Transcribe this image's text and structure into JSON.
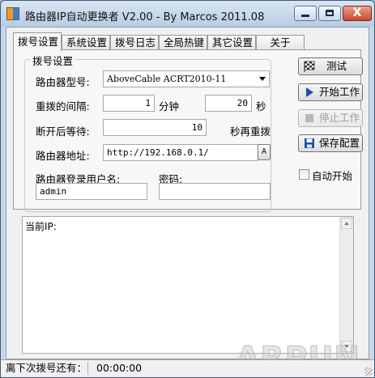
{
  "window": {
    "title": "路由器IP自动更换者 V2.00 - By Marcos 2011.08",
    "close_glyph": "X"
  },
  "tabs": [
    "拨号设置",
    "系统设置",
    "拨号日志",
    "全局热键",
    "其它设置",
    "关于"
  ],
  "dial_settings": {
    "group_label": "拨号设置",
    "router_model_label": "路由器型号:",
    "router_model_value": "AboveCable ACRT2010-11",
    "redial_interval_label": "重拨的间隔:",
    "redial_minutes_value": "1",
    "minutes_unit": "分钟",
    "redial_seconds_value": "20",
    "seconds_unit": "秒",
    "disconnect_wait_label": "断开后等待:",
    "disconnect_wait_value": "10",
    "disconnect_wait_suffix": "秒再重拨",
    "router_address_label": "路由器地址:",
    "router_address_value": "http://192.168.0.1/",
    "address_button_label": "A",
    "username_label": "路由器登录用户名:",
    "username_value": "admin",
    "password_label": "密码:",
    "password_value": ""
  },
  "actions": {
    "test_label": "测试",
    "start_label": "开始工作",
    "stop_label": "停止工作",
    "save_label": "保存配置",
    "autostart_label": "自动开始"
  },
  "log": {
    "current_ip_label": "当前IP:"
  },
  "watermark": "ARPUN",
  "status": {
    "next_dial_label": "离下次拨号还有：",
    "next_dial_value": "00:00:00"
  },
  "colors": {
    "title_bar": "#c4d6ea",
    "close_button": "#c9482b",
    "client_bg": "#f0f0f0",
    "start_icon": "#1f4fb0",
    "save_icon": "#1f4fb0"
  }
}
